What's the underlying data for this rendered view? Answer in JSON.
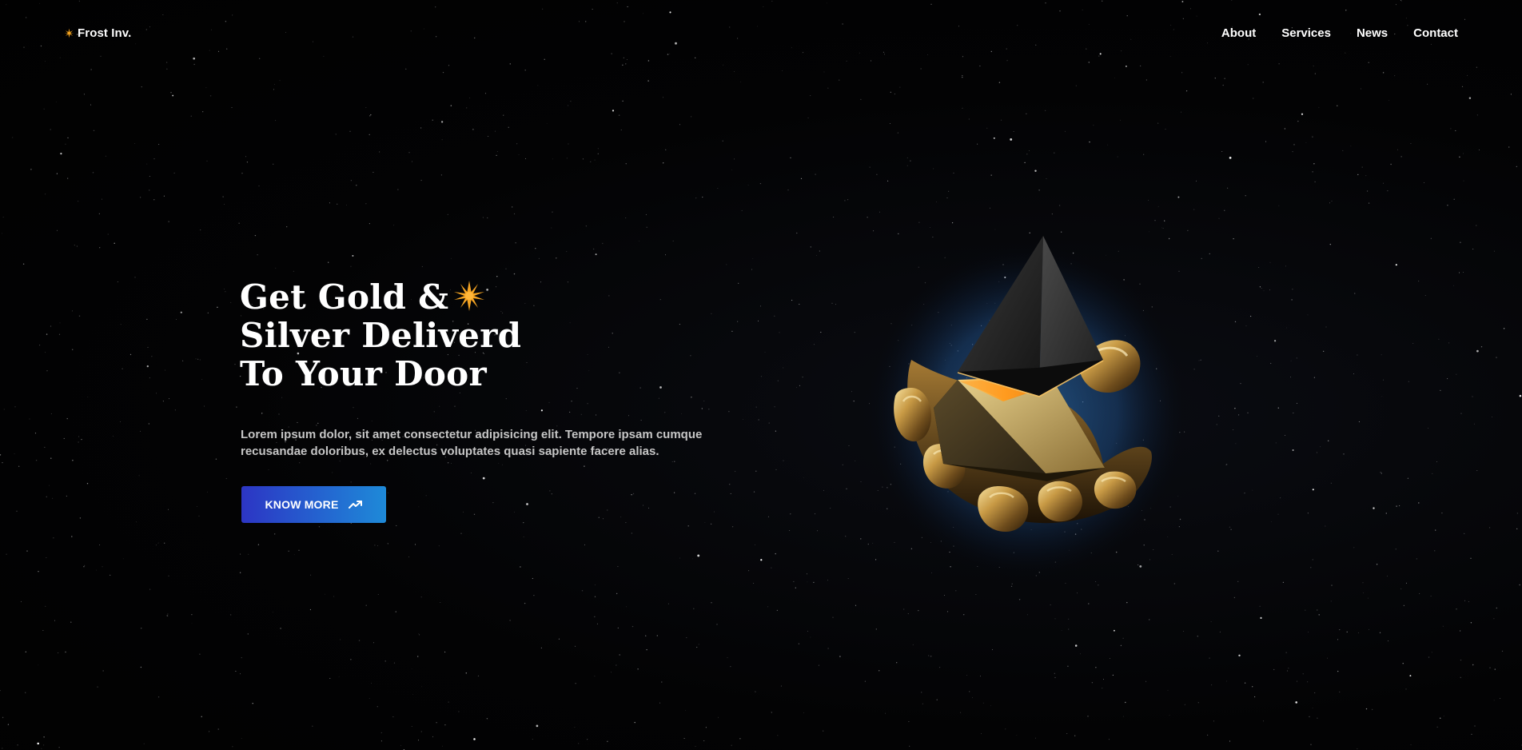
{
  "brand": {
    "name": "Frost Inv.",
    "icon": "sparkle-icon",
    "icon_color": "#f5a41f"
  },
  "nav": {
    "items": [
      {
        "label": "About"
      },
      {
        "label": "Services"
      },
      {
        "label": "News"
      },
      {
        "label": "Contact"
      }
    ]
  },
  "hero": {
    "title_lines": [
      "Get Gold &",
      "Silver Deliverd",
      "To Your Door"
    ],
    "title_icon": "sparkle-icon",
    "description": "Lorem ipsum dolor, sit amet consectetur adipisicing elit. Tempore ipsam cumque recusandae doloribus, ex delectus voluptates quasi sapiente facere alias.",
    "cta_label": "KNOW MORE",
    "cta_icon": "trending-up-arrow-icon",
    "illustration": "golden-hand-holding-pyramid"
  },
  "colors": {
    "background": "#020203",
    "accent": "#f5a41f",
    "button_gradient_start": "#2c35c4",
    "button_gradient_end": "#1e8ad8",
    "glow": "#3a8fe0"
  }
}
